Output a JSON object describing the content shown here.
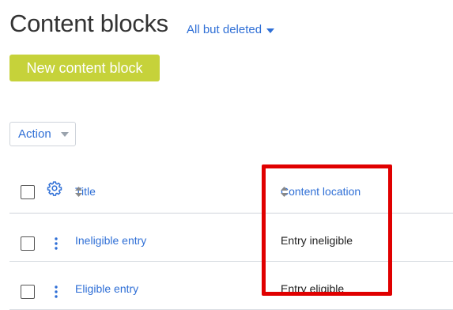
{
  "page": {
    "title": "Content blocks",
    "filter_label": "All but deleted",
    "new_button_label": "New content block",
    "action_label": "Action"
  },
  "table": {
    "columns": {
      "title": "Title",
      "location": "Content location"
    },
    "rows": [
      {
        "title": "Ineligible entry",
        "location": "Entry ineligible"
      },
      {
        "title": "Eligible entry",
        "location": "Entry eligible"
      }
    ]
  },
  "colors": {
    "link": "#2f6fd6",
    "new_button": "#c6d23a",
    "highlight": "#e00000"
  },
  "icons": [
    "gear-icon",
    "sort-icon",
    "kebab-icon",
    "chevron-down-icon"
  ]
}
